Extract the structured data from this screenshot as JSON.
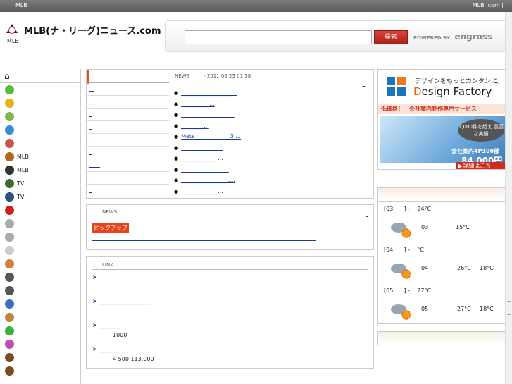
{
  "topbar": {
    "brand": "MLB",
    "right_link": "MLB          .com",
    "right_sep": "|"
  },
  "header": {
    "site_title": "MLB(ナ・リーグ)ニュース.com",
    "subtitle": "MLB",
    "search_placeholder": "",
    "search_button": "検索",
    "powered_by": "POWERED BY",
    "engross": "engross"
  },
  "leftnav": {
    "home_icon": "home-icon",
    "items": [
      {
        "label": "",
        "color": "#5cbb3a"
      },
      {
        "label": "",
        "color": "#e8b21a"
      },
      {
        "label": "",
        "color": "#88b24a"
      },
      {
        "label": "",
        "color": "#3a8cd0"
      },
      {
        "label": "",
        "color": "#c85454"
      },
      {
        "label": "MLB",
        "color": "#b5651d"
      },
      {
        "label": "MLB",
        "color": "#333333"
      },
      {
        "label": "TV",
        "color": "#3a6e2e"
      },
      {
        "label": "TV",
        "color": "#2a4e80"
      },
      {
        "label": "",
        "color": "#d02020"
      },
      {
        "label": "",
        "color": "#aaaaaa"
      },
      {
        "label": "",
        "color": "#aaaaaa"
      },
      {
        "label": "",
        "color": "#cccccc"
      },
      {
        "label": "",
        "color": "#d08040"
      },
      {
        "label": "",
        "color": "#555555"
      },
      {
        "label": "",
        "color": "#555555"
      },
      {
        "label": "",
        "color": "#3a70c0"
      },
      {
        "label": "",
        "color": "#c0843a"
      },
      {
        "label": "",
        "color": "#3ab040"
      },
      {
        "label": "",
        "color": "#c050b0"
      },
      {
        "label": "",
        "color": "#7a4a20"
      },
      {
        "label": "",
        "color": "#7a4a20"
      }
    ]
  },
  "main": {
    "news_label": "NEWS",
    "updated": "- 2011 06 23  01 58",
    "more": "_",
    "tabs": [
      "__",
      "_",
      "_",
      "_",
      "_",
      "_",
      "____",
      "_",
      "_"
    ],
    "news_items": [
      "__________________...",
      "__________...",
      "_________________...",
      "________...",
      "Mets ____________3 ...",
      "_____________...",
      "_____________...",
      "_______________...",
      "________________.....",
      "_____________..."
    ]
  },
  "pickup": {
    "news_label": "NEWS",
    "more": "_",
    "badge": "ピックアップ",
    "link": "_____________________________________________________________________________________...(____)"
  },
  "links": {
    "label": "LINK",
    "rows": [
      {
        "link": "",
        "sub": ""
      },
      {
        "link": "__________________",
        "sub": ""
      },
      {
        "link": "_______",
        "sub": "1000   !"
      },
      {
        "link": "__________",
        "sub": "4   500 113,000"
      }
    ]
  },
  "ad": {
    "top_text": "デザインをもっとカンタンに。",
    "brand_prefix": "D",
    "brand_rest": "esign Factory",
    "tagline": "低価格！　会社案内制作専門サービス",
    "bubble": "1,000件を超え\n豊富な実績",
    "sale": "会社案内4P100部",
    "price": "84,000円",
    "detail": "▶詳細はこち"
  },
  "weather": {
    "days": [
      {
        "header": "[03      ] -    24°C",
        "date": "03",
        "hi": "",
        "lo": "15°C",
        "icon": "sun-cloud-icon"
      },
      {
        "header": "[04      ] -    °C",
        "date": "04",
        "hi": "26°C",
        "lo": "18°C",
        "icon": "sun-cloud-icon"
      },
      {
        "header": "[05      ] -    27°C",
        "date": "05",
        "hi": "27°C",
        "lo": "18°C",
        "icon": "sun-cloud-icon"
      }
    ]
  }
}
